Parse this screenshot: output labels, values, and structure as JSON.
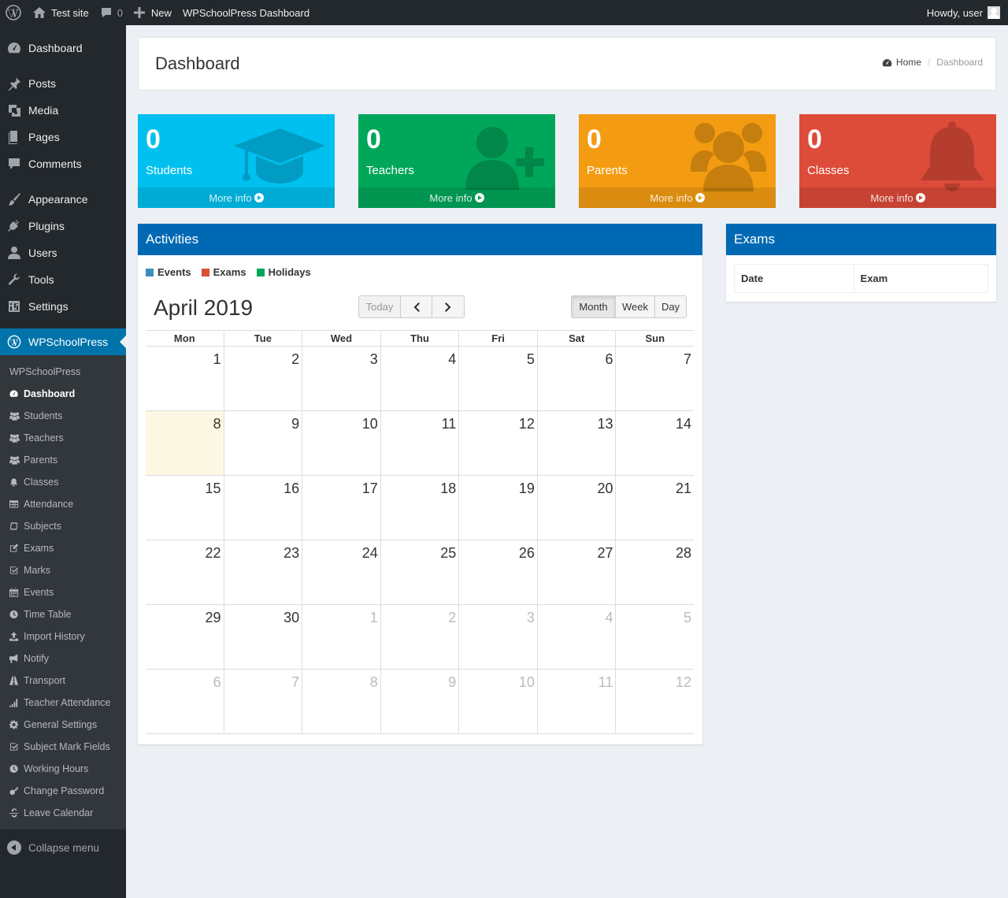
{
  "adminbar": {
    "site_name": "Test site",
    "comments_count": "0",
    "new_label": "New",
    "plugin_link": "WPSchoolPress Dashboard",
    "howdy": "Howdy, user"
  },
  "sidebar": {
    "items": [
      {
        "label": "Dashboard",
        "icon": "dashboard-icon"
      },
      {
        "label": "Posts",
        "icon": "pin-icon"
      },
      {
        "label": "Media",
        "icon": "media-icon"
      },
      {
        "label": "Pages",
        "icon": "pages-icon"
      },
      {
        "label": "Comments",
        "icon": "comment-icon"
      },
      {
        "label": "Appearance",
        "icon": "brush-icon"
      },
      {
        "label": "Plugins",
        "icon": "plug-icon"
      },
      {
        "label": "Users",
        "icon": "user-icon"
      },
      {
        "label": "Tools",
        "icon": "wrench-icon"
      },
      {
        "label": "Settings",
        "icon": "settings-icon"
      }
    ],
    "active": "WPSchoolPress",
    "submenu_title": "WPSchoolPress",
    "submenu": [
      {
        "label": "Dashboard",
        "icon": "dashboard-icon"
      },
      {
        "label": "Students",
        "icon": "users-icon"
      },
      {
        "label": "Teachers",
        "icon": "users-icon"
      },
      {
        "label": "Parents",
        "icon": "users-icon"
      },
      {
        "label": "Classes",
        "icon": "bell-icon"
      },
      {
        "label": "Attendance",
        "icon": "table-icon"
      },
      {
        "label": "Subjects",
        "icon": "book-icon"
      },
      {
        "label": "Exams",
        "icon": "edit-icon"
      },
      {
        "label": "Marks",
        "icon": "check-icon"
      },
      {
        "label": "Events",
        "icon": "calendar-icon"
      },
      {
        "label": "Time Table",
        "icon": "clock-icon"
      },
      {
        "label": "Import History",
        "icon": "upload-icon"
      },
      {
        "label": "Notify",
        "icon": "bullhorn-icon"
      },
      {
        "label": "Transport",
        "icon": "road-icon"
      },
      {
        "label": "Teacher Attendance",
        "icon": "signal-icon"
      },
      {
        "label": "General Settings",
        "icon": "gear-icon"
      },
      {
        "label": "Subject Mark Fields",
        "icon": "check-icon"
      },
      {
        "label": "Working Hours",
        "icon": "clock-icon"
      },
      {
        "label": "Change Password",
        "icon": "key-icon"
      },
      {
        "label": "Leave Calendar",
        "icon": "strikethrough-icon"
      }
    ],
    "collapse": "Collapse menu"
  },
  "header": {
    "title": "Dashboard",
    "breadcrumb_home": "Home",
    "breadcrumb_current": "Dashboard"
  },
  "stats": [
    {
      "count": "0",
      "label": "Students",
      "more": "More info",
      "color": "#00c0ef",
      "icon": "graduation-cap-icon"
    },
    {
      "count": "0",
      "label": "Teachers",
      "more": "More info",
      "color": "#00a65a",
      "icon": "user-plus-icon"
    },
    {
      "count": "0",
      "label": "Parents",
      "more": "More info",
      "color": "#f39c12",
      "icon": "users-icon"
    },
    {
      "count": "0",
      "label": "Classes",
      "more": "More info",
      "color": "#dd4b39",
      "icon": "bell-icon"
    }
  ],
  "activities": {
    "title": "Activities",
    "legend": [
      {
        "label": "Events",
        "color": "#3c8dbc"
      },
      {
        "label": "Exams",
        "color": "#dd4b39"
      },
      {
        "label": "Holidays",
        "color": "#00a65a"
      }
    ],
    "calendar": {
      "title": "April 2019",
      "today_label": "Today",
      "views": [
        "Month",
        "Week",
        "Day"
      ],
      "active_view": "Month",
      "weekdays": [
        "Mon",
        "Tue",
        "Wed",
        "Thu",
        "Fri",
        "Sat",
        "Sun"
      ],
      "weeks": [
        [
          "1",
          "2",
          "3",
          "4",
          "5",
          "6",
          "7"
        ],
        [
          "8",
          "9",
          "10",
          "11",
          "12",
          "13",
          "14"
        ],
        [
          "15",
          "16",
          "17",
          "18",
          "19",
          "20",
          "21"
        ],
        [
          "22",
          "23",
          "24",
          "25",
          "26",
          "27",
          "28"
        ],
        [
          "29",
          "30",
          "1",
          "2",
          "3",
          "4",
          "5"
        ],
        [
          "6",
          "7",
          "8",
          "9",
          "10",
          "11",
          "12"
        ]
      ],
      "today_date": "8"
    }
  },
  "exams": {
    "title": "Exams",
    "columns": [
      "Date",
      "Exam"
    ]
  }
}
